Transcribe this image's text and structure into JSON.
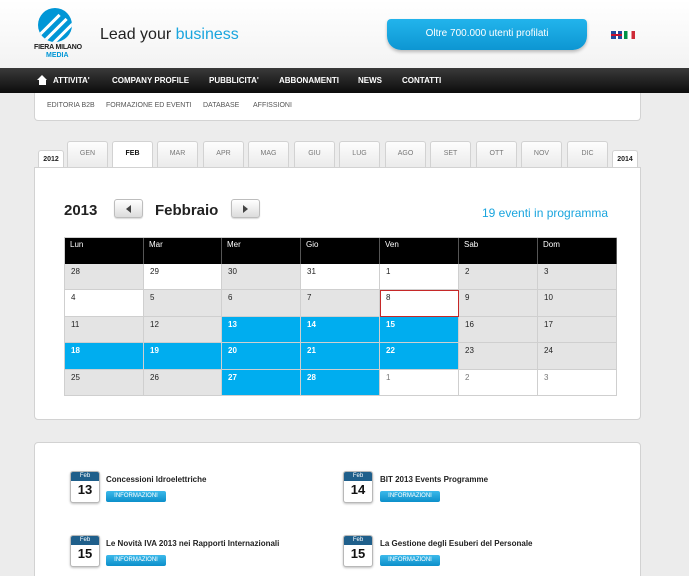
{
  "header": {
    "logo_line1": "FIERA MILANO",
    "logo_line2": "MEDIA",
    "tagline_prefix": "Lead your",
    "tagline_accent": "business",
    "users_pill": "Oltre 700.000 utenti profilati",
    "colors": {
      "brand_blue": "#0096d6",
      "accent": "#1aa5de",
      "event_day": "#00adef",
      "today_border": "#c62828"
    }
  },
  "nav": {
    "items": [
      "ATTIVITA'",
      "COMPANY PROFILE",
      "PUBBLICITA'",
      "ABBONAMENTI",
      "NEWS",
      "CONTATTI"
    ],
    "home_icon": "home-icon"
  },
  "subnav": {
    "items": [
      "EDITORIA B2B",
      "FORMAZIONE ED EVENTI",
      "DATABASE",
      "AFFISSIONI"
    ]
  },
  "month_tabs": {
    "prev_year": "2012",
    "next_year": "2014",
    "months": [
      "GEN",
      "FEB",
      "MAR",
      "APR",
      "MAG",
      "GIU",
      "LUG",
      "AGO",
      "SET",
      "OTT",
      "NOV",
      "DIC"
    ],
    "active": "FEB"
  },
  "calendar": {
    "year": "2013",
    "month": "Febbraio",
    "events_count": "19 eventi in programma",
    "weekdays": [
      "Lun",
      "Mar",
      "Mer",
      "Gio",
      "Ven",
      "Sab",
      "Dom"
    ],
    "weeks": [
      [
        {
          "d": "28",
          "s": "gray"
        },
        {
          "d": "29",
          "s": "white"
        },
        {
          "d": "30",
          "s": "gray"
        },
        {
          "d": "31",
          "s": "white"
        },
        {
          "d": "1",
          "s": "white"
        },
        {
          "d": "2",
          "s": "gray"
        },
        {
          "d": "3",
          "s": "gray"
        }
      ],
      [
        {
          "d": "4",
          "s": "white"
        },
        {
          "d": "5",
          "s": "gray"
        },
        {
          "d": "6",
          "s": "gray"
        },
        {
          "d": "7",
          "s": "gray"
        },
        {
          "d": "8",
          "s": "today"
        },
        {
          "d": "9",
          "s": "gray"
        },
        {
          "d": "10",
          "s": "gray"
        }
      ],
      [
        {
          "d": "11",
          "s": "gray"
        },
        {
          "d": "12",
          "s": "gray"
        },
        {
          "d": "13",
          "s": "blue"
        },
        {
          "d": "14",
          "s": "blue"
        },
        {
          "d": "15",
          "s": "blue"
        },
        {
          "d": "16",
          "s": "gray"
        },
        {
          "d": "17",
          "s": "gray"
        }
      ],
      [
        {
          "d": "18",
          "s": "blue"
        },
        {
          "d": "19",
          "s": "blue"
        },
        {
          "d": "20",
          "s": "blue"
        },
        {
          "d": "21",
          "s": "blue"
        },
        {
          "d": "22",
          "s": "blue"
        },
        {
          "d": "23",
          "s": "gray"
        },
        {
          "d": "24",
          "s": "gray"
        }
      ],
      [
        {
          "d": "25",
          "s": "gray"
        },
        {
          "d": "26",
          "s": "gray"
        },
        {
          "d": "27",
          "s": "blue"
        },
        {
          "d": "28",
          "s": "blue"
        },
        {
          "d": "1",
          "s": "other"
        },
        {
          "d": "2",
          "s": "other"
        },
        {
          "d": "3",
          "s": "other"
        }
      ]
    ]
  },
  "events": {
    "button_label": "INFORMAZIONI",
    "items": [
      {
        "month": "Feb",
        "day": "13",
        "title": "Concessioni Idroelettriche"
      },
      {
        "month": "Feb",
        "day": "14",
        "title": "BIT 2013 Events Programme"
      },
      {
        "month": "Feb",
        "day": "15",
        "title": "Le Novità IVA 2013 nei Rapporti Internazionali"
      },
      {
        "month": "Feb",
        "day": "15",
        "title": "La Gestione degli Esuberi del Personale"
      }
    ]
  }
}
